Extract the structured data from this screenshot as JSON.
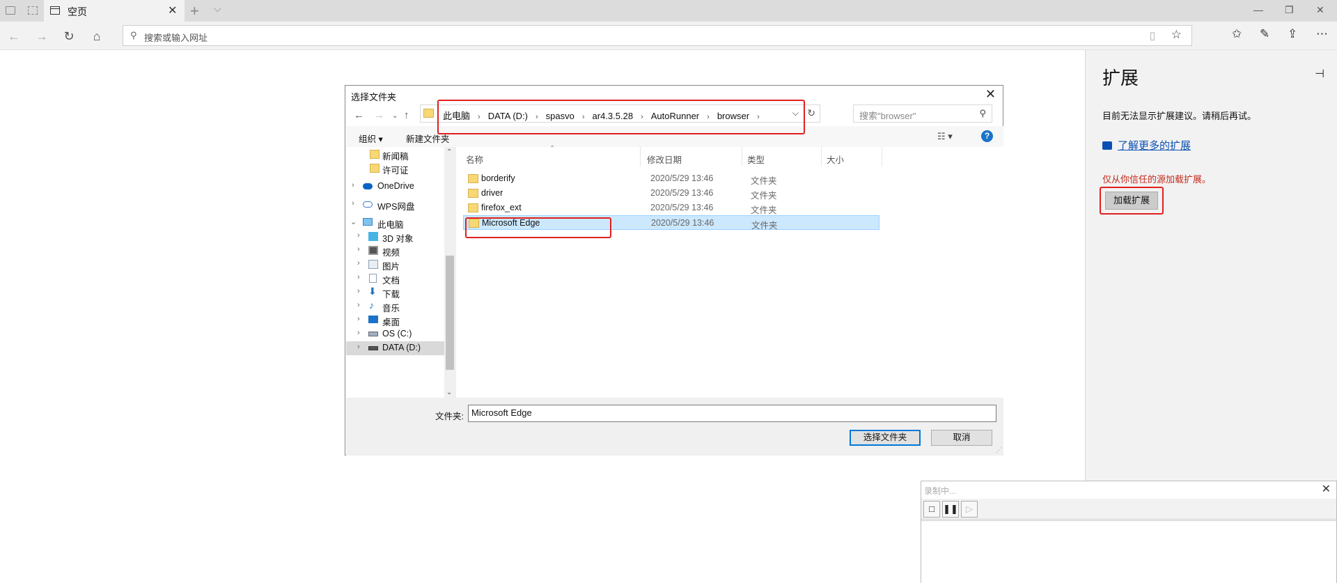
{
  "browser": {
    "tab_title": "空页",
    "address_placeholder": "搜索或输入网址"
  },
  "extensions": {
    "heading": "扩展",
    "message": "目前无法显示扩展建议。请稍后再试。",
    "learn_more": "了解更多的扩展",
    "warning": "仅从你信任的源加载扩展。",
    "load_button": "加载扩展"
  },
  "dialog": {
    "title": "选择文件夹",
    "breadcrumb": [
      "此电脑",
      "DATA (D:)",
      "spasvo",
      "ar4.3.5.28",
      "AutoRunner",
      "browser"
    ],
    "search_placeholder": "搜索\"browser\"",
    "toolbar": {
      "organize": "组织 ▾",
      "new_folder": "新建文件夹"
    },
    "tree": [
      {
        "label": "新闻稿",
        "icon": "folder-icon"
      },
      {
        "label": "许可证",
        "icon": "folder-icon"
      },
      {
        "label": "OneDrive",
        "icon": "cloud-icon"
      },
      {
        "label": "WPS网盘",
        "icon": "cloud-icon"
      },
      {
        "label": "此电脑",
        "icon": "computer-icon"
      },
      {
        "label": "3D 对象",
        "icon": "cube-icon"
      },
      {
        "label": "视频",
        "icon": "video-icon"
      },
      {
        "label": "图片",
        "icon": "picture-icon"
      },
      {
        "label": "文档",
        "icon": "document-icon"
      },
      {
        "label": "下载",
        "icon": "download-icon"
      },
      {
        "label": "音乐",
        "icon": "music-icon"
      },
      {
        "label": "桌面",
        "icon": "desktop-icon"
      },
      {
        "label": "OS (C:)",
        "icon": "drive-icon"
      },
      {
        "label": "DATA (D:)",
        "icon": "drive-icon"
      }
    ],
    "columns": [
      "名称",
      "修改日期",
      "类型",
      "大小"
    ],
    "files": [
      {
        "name": "borderify",
        "date": "2020/5/29 13:46",
        "type": "文件夹"
      },
      {
        "name": "driver",
        "date": "2020/5/29 13:46",
        "type": "文件夹"
      },
      {
        "name": "firefox_ext",
        "date": "2020/5/29 13:46",
        "type": "文件夹"
      },
      {
        "name": "Microsoft Edge",
        "date": "2020/5/29 13:46",
        "type": "文件夹"
      }
    ],
    "folder_label": "文件夹:",
    "folder_value": "Microsoft Edge",
    "select_button": "选择文件夹",
    "cancel_button": "取消"
  },
  "recorder": {
    "title": "录制中..."
  },
  "colors": {
    "highlight_red": "#e01f1f",
    "link_blue": "#0a50b4",
    "warning_red": "#c42b1c",
    "selection_blue": "#cce8ff"
  }
}
